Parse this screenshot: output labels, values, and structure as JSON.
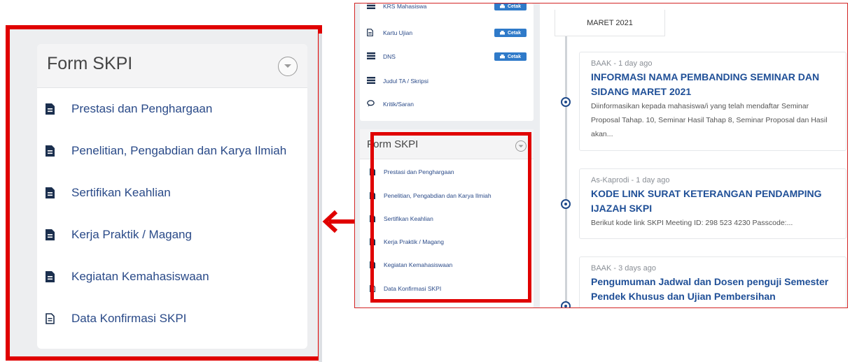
{
  "zoom_panel": {
    "title": "Form SKPI",
    "items": [
      {
        "label": "Prestasi dan Penghargaan",
        "icon": "file-solid-icon"
      },
      {
        "label": "Penelitian, Pengabdian dan Karya Ilmiah",
        "icon": "file-solid-icon"
      },
      {
        "label": "Sertifikan Keahlian",
        "icon": "file-solid-icon"
      },
      {
        "label": "Kerja Praktik / Magang",
        "icon": "file-solid-icon"
      },
      {
        "label": "Kegiatan Kemahasiswaan",
        "icon": "file-solid-icon"
      },
      {
        "label": "Data Konfirmasi SKPI",
        "icon": "file-outline-icon"
      }
    ]
  },
  "menu": {
    "items": [
      {
        "label": "KRS Mahasiswa",
        "action": "Cetak"
      },
      {
        "label": "Kartu Ujian",
        "action": "Cetak"
      },
      {
        "label": "DNS",
        "action": "Cetak"
      },
      {
        "label": "Judul TA / Skripsi"
      },
      {
        "label": "Kritik/Saran"
      }
    ]
  },
  "skpi_card": {
    "title": "Form SKPI",
    "items": [
      {
        "label": "Prestasi dan Penghargaan"
      },
      {
        "label": "Penelitian, Pengabdian dan Karya Ilmiah"
      },
      {
        "label": "Sertifikan Keahlian"
      },
      {
        "label": "Kerja Praktik / Magang"
      },
      {
        "label": "Kegiatan Kemahasiswaan"
      },
      {
        "label": "Data Konfirmasi SKPI"
      }
    ]
  },
  "feed": {
    "month": "MARET 2021",
    "posts": [
      {
        "meta": "BAAK - 1 day ago",
        "title": "INFORMASI NAMA PEMBANDING SEMINAR DAN SIDANG MARET 2021",
        "body": "Diinformasikan kepada mahasiswa/i yang telah mendaftar Seminar Proposal Tahap. 10, Seminar Hasil Tahap 8, Seminar Proposal dan Hasil akan..."
      },
      {
        "meta": "As-Kaprodi - 1 day ago",
        "title": "KODE LINK SURAT KETERANGAN PENDAMPING IJAZAH SKPI",
        "body": "Berikut kode link SKPI Meeting ID: 298 523 4230 Passcode:..."
      },
      {
        "meta": "BAAK - 3 days ago",
        "title": "Pengumuman Jadwal dan Dosen penguji Semester Pendek Khusus dan Ujian Pembersihan",
        "body": ""
      }
    ]
  },
  "colors": {
    "highlight": "#e00000",
    "link": "#2a4a88",
    "title_blue": "#1f4f97",
    "button_blue": "#2f7ac9"
  }
}
